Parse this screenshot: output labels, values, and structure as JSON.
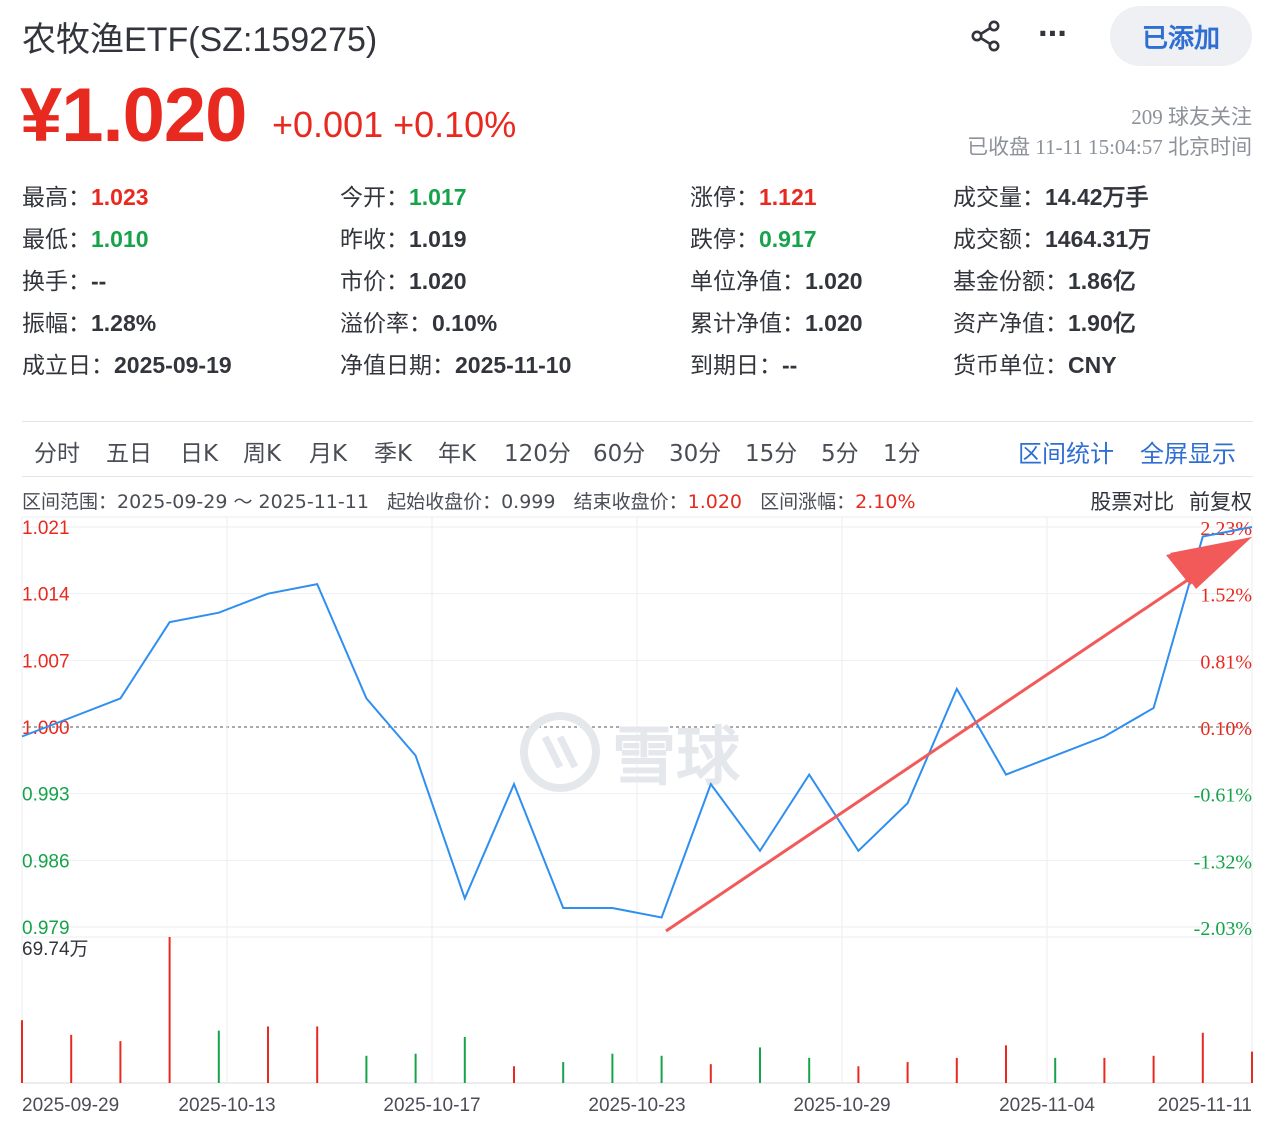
{
  "header": {
    "title": "农牧渔ETF(SZ:159275)",
    "added_label": "已添加",
    "more_label": "···"
  },
  "quote": {
    "price": "¥1.020",
    "change": "+0.001  +0.10%",
    "followers": "209 球友关注",
    "status": "已收盘 11-11 15:04:57 北京时间"
  },
  "stats": {
    "high_label": "最高：",
    "high": "1.023",
    "low_label": "最低：",
    "low": "1.010",
    "turnover_label": "换手：",
    "turnover": "--",
    "amplitude_label": "振幅：",
    "amplitude": "1.28%",
    "founded_label": "成立日：",
    "founded": "2025-09-19",
    "open_label": "今开：",
    "open": "1.017",
    "prev_close_label": "昨收：",
    "prev_close": "1.019",
    "market_price_label": "市价：",
    "market_price": "1.020",
    "premium_label": "溢价率：",
    "premium": "0.10%",
    "nav_date_label": "净值日期：",
    "nav_date": "2025-11-10",
    "limit_up_label": "涨停：",
    "limit_up": "1.121",
    "limit_down_label": "跌停：",
    "limit_down": "0.917",
    "unit_nav_label": "单位净值：",
    "unit_nav": "1.020",
    "cum_nav_label": "累计净值：",
    "cum_nav": "1.020",
    "expiry_label": "到期日：",
    "expiry": "--",
    "volume_label": "成交量：",
    "volume": "14.42万手",
    "amount_label": "成交额：",
    "amount": "1464.31万",
    "fund_shares_label": "基金份额：",
    "fund_shares": "1.86亿",
    "net_assets_label": "资产净值：",
    "net_assets": "1.90亿",
    "currency_label": "货币单位：",
    "currency": "CNY"
  },
  "tabs": [
    "分时",
    "五日",
    "日K",
    "周K",
    "月K",
    "季K",
    "年K",
    "120分",
    "60分",
    "30分",
    "15分",
    "5分",
    "1分"
  ],
  "tab_actions": {
    "range_stats": "区间统计",
    "fullscreen": "全屏显示"
  },
  "range": {
    "range_label": "区间范围：",
    "range_value": "2025-09-29 ～ 2025-11-11",
    "start_label": "起始收盘价：",
    "start_value": "0.999",
    "end_label": "结束收盘价：",
    "end_value": "1.020",
    "change_label": "区间涨幅：",
    "change_value": "2.10%"
  },
  "tools": {
    "compare": "股票对比",
    "adjust": "前复权"
  },
  "watermark": "雪球",
  "colors": {
    "up": "#e8291f",
    "down": "#16a34a",
    "line": "#2f8ff0",
    "accent": "#2f6fd4"
  },
  "chart_data": {
    "type": "line",
    "base_price": 0.999,
    "y_price_ticks": [
      "1.021",
      "1.014",
      "1.007",
      "1.000",
      "0.993",
      "0.986",
      "0.979"
    ],
    "y_pct_ticks": [
      "2.23%",
      "1.52%",
      "0.81%",
      "0.10%",
      "-0.61%",
      "-1.32%",
      "-2.03%"
    ],
    "ylim": [
      0.979,
      1.021
    ],
    "x_tick_labels": [
      "2025-09-29",
      "2025-10-13",
      "2025-10-17",
      "2025-10-23",
      "2025-10-29",
      "2025-11-04",
      "2025-11-11"
    ],
    "dates": [
      "2025-09-29",
      "2025-09-30",
      "2025-10-09",
      "2025-10-10",
      "2025-10-13",
      "2025-10-14",
      "2025-10-15",
      "2025-10-16",
      "2025-10-17",
      "2025-10-20",
      "2025-10-21",
      "2025-10-22",
      "2025-10-23",
      "2025-10-24",
      "2025-10-27",
      "2025-10-28",
      "2025-10-29",
      "2025-10-30",
      "2025-10-31",
      "2025-11-03",
      "2025-11-04",
      "2025-11-05",
      "2025-11-06",
      "2025-11-07",
      "2025-11-10",
      "2025-11-11"
    ],
    "close": [
      0.999,
      1.001,
      1.003,
      1.011,
      1.012,
      1.014,
      1.015,
      1.003,
      0.997,
      0.982,
      0.994,
      0.981,
      0.981,
      0.98,
      0.994,
      0.987,
      0.995,
      0.987,
      0.992,
      1.004,
      0.995,
      0.997,
      0.999,
      1.002,
      1.02,
      1.021
    ],
    "volume_max_label": "69.74万",
    "volume_max": 69.74,
    "volume": [
      30,
      23,
      20,
      69.74,
      25,
      27,
      27,
      13,
      14,
      22,
      8,
      10,
      14,
      13,
      9,
      17,
      12,
      8,
      10,
      12,
      18,
      12,
      12,
      13,
      24,
      15
    ],
    "volume_dir": [
      "up",
      "up",
      "up",
      "up",
      "down",
      "up",
      "up",
      "down",
      "down",
      "down",
      "up",
      "down",
      "down",
      "down",
      "up",
      "down",
      "down",
      "up",
      "up",
      "up",
      "up",
      "down",
      "up",
      "up",
      "up",
      "up"
    ]
  }
}
